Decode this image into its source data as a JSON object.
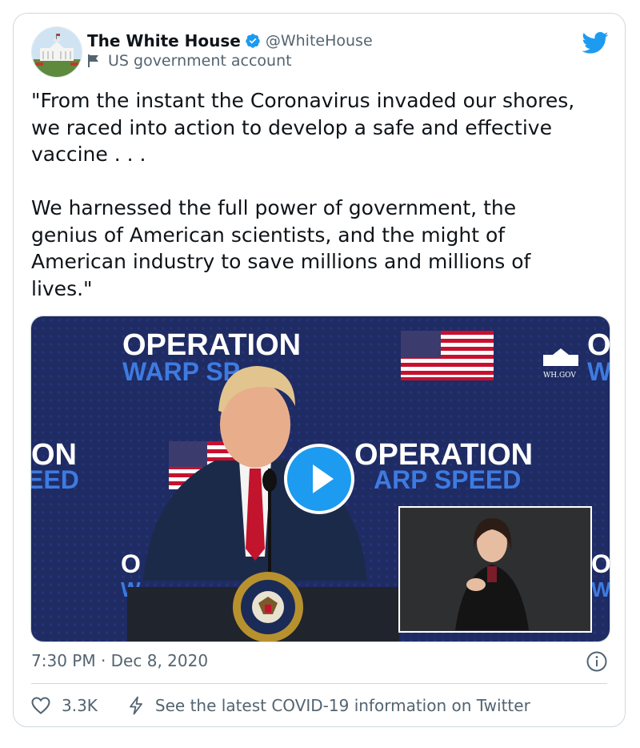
{
  "author": {
    "name": "The White House",
    "handle": "@WhiteHouse",
    "label": "US government account"
  },
  "tweet": {
    "text": "\"From the instant the Coronavirus invaded our shores,\nwe raced into action to develop a safe and effective\nvaccine . . .\n\nWe harnessed the full power of government, the\ngenius of American scientists, and the might of\nAmerican industry to save millions and millions of\nlives.\"",
    "timestamp": "7:30 PM · Dec 8, 2020"
  },
  "media": {
    "banner_line1": "OPERATION",
    "banner_line2": "WARP SPEED",
    "banner_line2_partial": "WARP SP",
    "left_edge_line1": "ON",
    "left_edge_line2": "EED",
    "center_line1": "OPERATION",
    "center_line2": "ARP SPEED",
    "whgov": "WH.GOV",
    "seal_text": "PRESIDENT OF THE UNITED STATES"
  },
  "footer": {
    "likes": "3.3K",
    "covid_link": "See the latest COVID-19 information on Twitter"
  },
  "colors": {
    "twitter_blue": "#1d9bf0",
    "secondary_text": "#536471",
    "primary_text": "#0f1419",
    "stage_blue": "#1f2b63"
  }
}
